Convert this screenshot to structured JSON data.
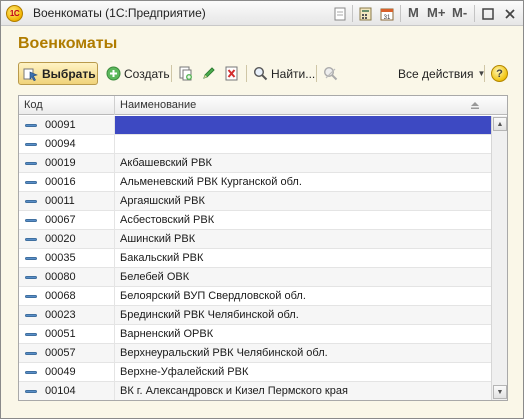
{
  "window": {
    "title": "Военкоматы  (1С:Предприятие)",
    "logo_text": "1С",
    "mem_buttons": [
      "M",
      "M+",
      "M-"
    ]
  },
  "heading": "Военкоматы",
  "toolbar": {
    "select_label": "Выбрать",
    "create_label": "Создать",
    "find_label": "Найти...",
    "all_actions_label": "Все действия",
    "help_label": "?"
  },
  "table": {
    "columns": [
      "Код",
      "Наименование"
    ],
    "rows": [
      {
        "code": "00091",
        "name": ""
      },
      {
        "code": "00094",
        "name": ""
      },
      {
        "code": "00019",
        "name": "Акбашевский РВК"
      },
      {
        "code": "00016",
        "name": "Альменевский РВК Курганской обл."
      },
      {
        "code": "00011",
        "name": "Аргаяшский РВК"
      },
      {
        "code": "00067",
        "name": "Асбестовский РВК"
      },
      {
        "code": "00020",
        "name": "Ашинский РВК"
      },
      {
        "code": "00035",
        "name": "Бакальский РВК"
      },
      {
        "code": "00080",
        "name": "Белебей ОВК"
      },
      {
        "code": "00068",
        "name": "Белоярский ВУП Свердловской обл."
      },
      {
        "code": "00023",
        "name": "Брединский РВК Челябинской обл."
      },
      {
        "code": "00051",
        "name": "Варненский ОРВК"
      },
      {
        "code": "00057",
        "name": "Верхнеуральский РВК Челябинской обл."
      },
      {
        "code": "00049",
        "name": "Верхне-Уфалейский РВК"
      },
      {
        "code": "00104",
        "name": "ВК г. Александровск и Кизел Пермского края"
      }
    ],
    "selected_row": 0
  },
  "colors": {
    "heading": "#b07c00",
    "selection": "#3d49c2",
    "accent_button": "#f0d37a"
  }
}
